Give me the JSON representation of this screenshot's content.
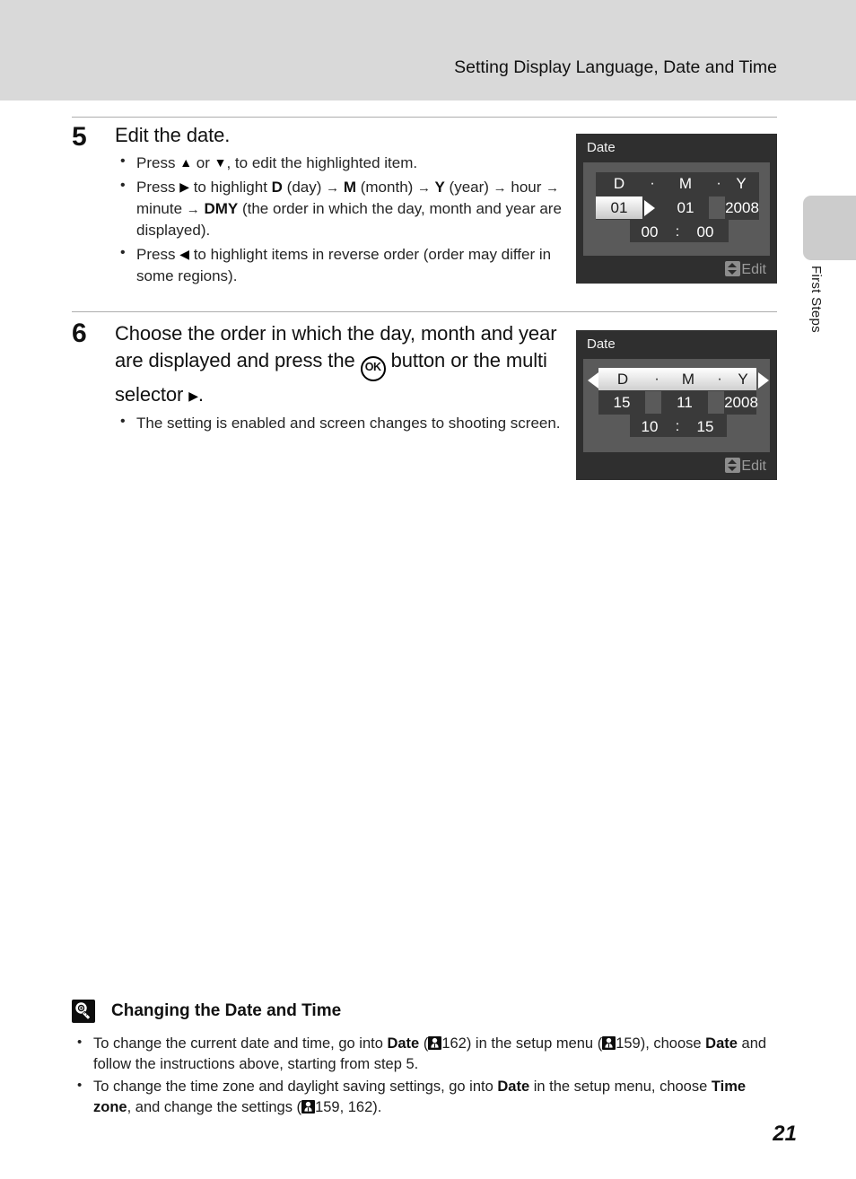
{
  "header": {
    "title": "Setting Display Language, Date and Time"
  },
  "side_tab": {
    "label": "First Steps"
  },
  "steps": [
    {
      "number": "5",
      "heading": "Edit the date.",
      "bullets": [
        {
          "parts": [
            {
              "t": "text",
              "v": "Press "
            },
            {
              "t": "icon",
              "v": "triangle-up"
            },
            {
              "t": "text",
              "v": " or "
            },
            {
              "t": "icon",
              "v": "triangle-down"
            },
            {
              "t": "text",
              "v": ", to edit the highlighted item."
            }
          ]
        },
        {
          "parts": [
            {
              "t": "text",
              "v": "Press "
            },
            {
              "t": "icon",
              "v": "triangle-right"
            },
            {
              "t": "text",
              "v": " to highlight "
            },
            {
              "t": "bold",
              "v": "D"
            },
            {
              "t": "text",
              "v": " (day) "
            },
            {
              "t": "arrow",
              "v": "→"
            },
            {
              "t": "bold",
              "v": " M"
            },
            {
              "t": "text",
              "v": " (month) "
            },
            {
              "t": "arrow",
              "v": "→"
            },
            {
              "t": "bold",
              "v": " Y"
            },
            {
              "t": "text",
              "v": " (year) "
            },
            {
              "t": "arrow",
              "v": "→"
            },
            {
              "t": "text",
              "v": " hour "
            },
            {
              "t": "arrow",
              "v": "→"
            },
            {
              "t": "text",
              "v": " minute "
            },
            {
              "t": "arrow",
              "v": "→"
            },
            {
              "t": "bold",
              "v": " DMY"
            },
            {
              "t": "text",
              "v": " (the order in which the day, month and year are displayed)."
            }
          ]
        },
        {
          "parts": [
            {
              "t": "text",
              "v": "Press "
            },
            {
              "t": "icon",
              "v": "triangle-left"
            },
            {
              "t": "text",
              "v": " to highlight items in reverse order (order may differ in some regions)."
            }
          ]
        }
      ]
    },
    {
      "number": "6",
      "heading_parts": [
        {
          "t": "text",
          "v": "Choose the order in which the day, month and year are displayed and press the "
        },
        {
          "t": "icon",
          "v": "ok-button"
        },
        {
          "t": "text",
          "v": " button or the multi selector "
        },
        {
          "t": "icon",
          "v": "triangle-right"
        },
        {
          "t": "text",
          "v": "."
        }
      ],
      "bullets": [
        {
          "parts": [
            {
              "t": "text",
              "v": "The setting is enabled and screen changes to shooting screen."
            }
          ]
        }
      ]
    }
  ],
  "screens": [
    {
      "title": "Date",
      "headers": {
        "d": "D",
        "m": "M",
        "y": "Y",
        "sep1": "·",
        "sep2": "·"
      },
      "values": {
        "day": "01",
        "month": "01",
        "year": "2008",
        "hour": "00",
        "minute": "00",
        "time_sep": ":"
      },
      "highlighted_field": "day",
      "cursor": "right",
      "footer_hint": "Edit",
      "footer_icon": "up-down-arrow-icon"
    },
    {
      "title": "Date",
      "headers": {
        "d": "D",
        "m": "M",
        "y": "Y",
        "sep1": "·",
        "sep2": "·"
      },
      "values": {
        "day": "15",
        "month": "11",
        "year": "2008",
        "hour": "10",
        "minute": "15",
        "time_sep": ":"
      },
      "highlighted_field": "dmy-order-row",
      "cursor": "both",
      "footer_hint": "Edit",
      "footer_icon": "up-down-arrow-icon"
    }
  ],
  "note": {
    "icon": "lightbulb-tip-icon",
    "title": "Changing the Date and Time",
    "items": [
      {
        "parts": [
          {
            "t": "text",
            "v": "To change the current date and time, go into "
          },
          {
            "t": "bold",
            "v": "Date"
          },
          {
            "t": "text",
            "v": " ("
          },
          {
            "t": "pgref",
            "v": "setup-menu-icon"
          },
          {
            "t": "text",
            "v": "162) in the setup menu ("
          },
          {
            "t": "pgref",
            "v": "setup-menu-icon"
          },
          {
            "t": "text",
            "v": "159), choose "
          },
          {
            "t": "bold",
            "v": "Date"
          },
          {
            "t": "text",
            "v": " and follow the instructions above, starting from step 5."
          }
        ]
      },
      {
        "parts": [
          {
            "t": "text",
            "v": "To change the time zone and daylight saving settings, go into "
          },
          {
            "t": "bold",
            "v": "Date"
          },
          {
            "t": "text",
            "v": " in the setup menu, choose "
          },
          {
            "t": "bold",
            "v": "Time zone"
          },
          {
            "t": "text",
            "v": ", and change the settings ("
          },
          {
            "t": "pgref",
            "v": "setup-menu-icon"
          },
          {
            "t": "text",
            "v": "159, 162)."
          }
        ]
      }
    ]
  },
  "page_number": "21",
  "colors": {
    "header_band": "#d9d9d9",
    "side_tab": "#cccccc",
    "screen_frame": "#2f2f2f",
    "screen_stage": "#5a5a5a",
    "screen_panel": "#3a3a3a",
    "highlight": "#ffffff",
    "rule": "#adadad"
  }
}
